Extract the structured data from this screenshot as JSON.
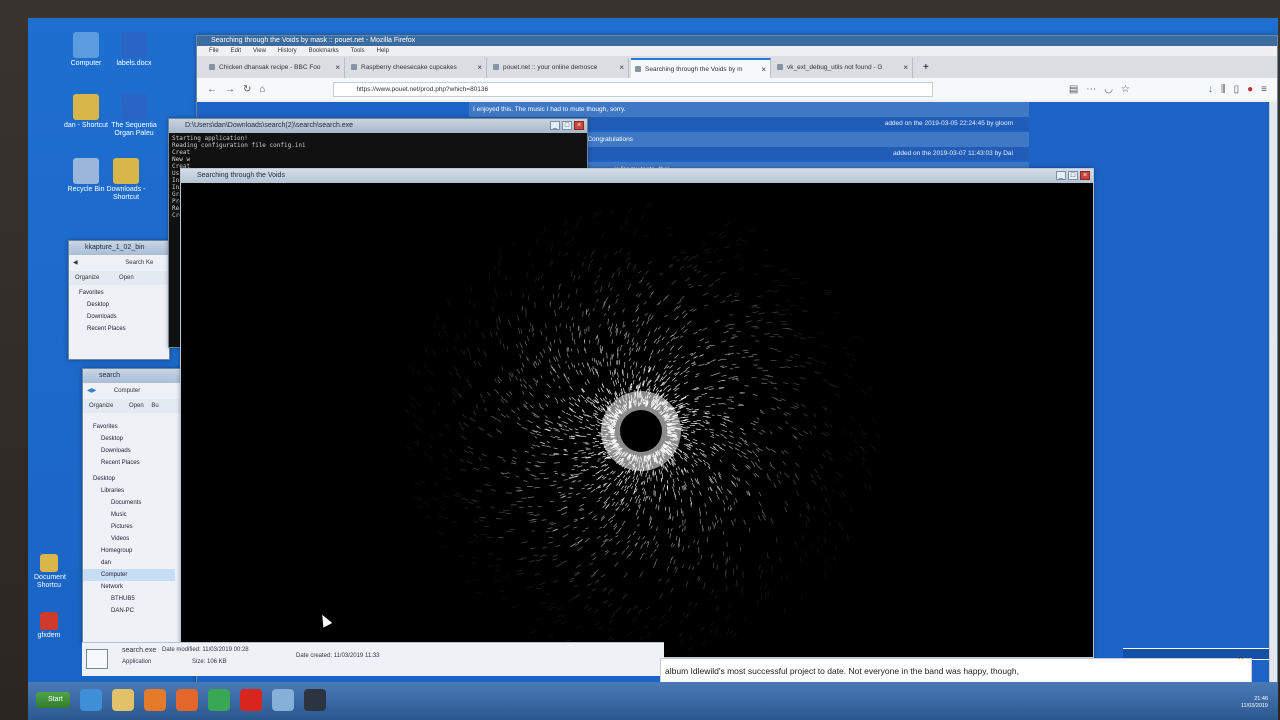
{
  "desktop": {
    "icons": [
      {
        "label": "Computer",
        "color": "#5b9be0"
      },
      {
        "label": "labels.docx",
        "color": "#2a64c4"
      },
      {
        "label": "dan - Shortcut",
        "color": "#d9b64a"
      },
      {
        "label": "The Sequentia Organ Paleu",
        "color": "#2a64c4"
      },
      {
        "label": "Recycle Bin",
        "color": "#9ab7d9"
      },
      {
        "label": "Downloads - Shortcut",
        "color": "#d9b64a"
      },
      {
        "label": "Document Shortcu",
        "color": "#d9b64a"
      },
      {
        "label": "gfxdem",
        "color": "#cc3b2e"
      }
    ]
  },
  "firefox": {
    "title": "Searching through the Voids by mask :: pouet.net - Mozilla Firefox",
    "menu": [
      "File",
      "Edit",
      "View",
      "History",
      "Bookmarks",
      "Tools",
      "Help"
    ],
    "tabs": [
      {
        "label": "Chicken dhansak recipe - BBC Foo",
        "active": false
      },
      {
        "label": "Raspberry cheesecake cupcakes",
        "active": false
      },
      {
        "label": "pouet.net :: your online demosce",
        "active": false
      },
      {
        "label": "Searching through the Voids by m",
        "active": true
      },
      {
        "label": "vk_ext_debug_utils not found - G",
        "active": false
      }
    ],
    "new_tab": "+",
    "url": "https://www.pouet.net/prod.php?which=80136",
    "comments": [
      {
        "text": "I enjoyed this. The music I had to mute though, sorry.",
        "meta": "added on the 2019-03-05 22:24:45 by gloom"
      },
      {
        "text": "This is lovely. And I liked the music too. Congratulations",
        "meta": "added on the 2019-03-07 11:43:03 by Dal"
      },
      {
        "text": "...ic for my taste, tho'.",
        "meta": ""
      }
    ]
  },
  "console": {
    "title": "D:\\Users\\dan\\Downloads\\search(2)\\search\\search.exe",
    "lines": [
      "Starting application!",
      "Reading configuration file config.ini",
      "Creat",
      "New w",
      "Creat",
      "Using",
      "Initi",
      "Initi",
      "Graph",
      "Prese",
      "Ready",
      "Creat"
    ]
  },
  "demo_window": {
    "title": "Searching through the Voids"
  },
  "explorer_windows": [
    {
      "title": "kkapture_1_02_bin",
      "search": "Search Ke",
      "toolbar": [
        "Organize",
        "Open"
      ],
      "tree": [
        "Favorites",
        "Desktop",
        "Downloads",
        "Recent Places"
      ]
    },
    {
      "title": "search",
      "breadcrumb": "Computer",
      "toolbar": [
        "Organize",
        "Open",
        "Bu"
      ],
      "tree": [
        {
          "label": "Favorites",
          "level": 1
        },
        {
          "label": "Desktop",
          "level": 2
        },
        {
          "label": "Downloads",
          "level": 2
        },
        {
          "label": "Recent Places",
          "level": 2
        },
        {
          "label": "Desktop",
          "level": 1
        },
        {
          "label": "Libraries",
          "level": 2
        },
        {
          "label": "Documents",
          "level": 3
        },
        {
          "label": "Music",
          "level": 3
        },
        {
          "label": "Pictures",
          "level": 3
        },
        {
          "label": "Videos",
          "level": 3
        },
        {
          "label": "Homegroup",
          "level": 2
        },
        {
          "label": "dan",
          "level": 2
        },
        {
          "label": "Computer",
          "level": 2,
          "selected": true
        },
        {
          "label": "Network",
          "level": 2
        },
        {
          "label": "BTHUB5",
          "level": 3
        },
        {
          "label": "DAN-PC",
          "level": 3
        }
      ]
    }
  ],
  "details": {
    "filename": "search.exe",
    "type": "Application",
    "date_modified": "Date modified: 11/03/2019 00:28",
    "size": "Size: 106 KB",
    "date_created": "Date created: 11/03/2019 11:33"
  },
  "ticker": {
    "text": "album Idlewild's most successful project to date. Not everyone in the band was happy, though,",
    "close": "×"
  },
  "taskbar": {
    "start": "Start",
    "clock_time": "21:46",
    "clock_date": "11/03/2019",
    "pinned": [
      {
        "name": "ie-icon",
        "color": "#3f8fd8"
      },
      {
        "name": "explorer-icon",
        "color": "#e2c16b"
      },
      {
        "name": "media-player-icon",
        "color": "#e57a2a"
      },
      {
        "name": "firefox-icon",
        "color": "#e5662a"
      },
      {
        "name": "chrome-icon",
        "color": "#3aa757"
      },
      {
        "name": "opera-icon",
        "color": "#d8261e"
      },
      {
        "name": "folder-icon",
        "color": "#86b0d8"
      },
      {
        "name": "console-icon",
        "color": "#2c3440"
      }
    ]
  }
}
